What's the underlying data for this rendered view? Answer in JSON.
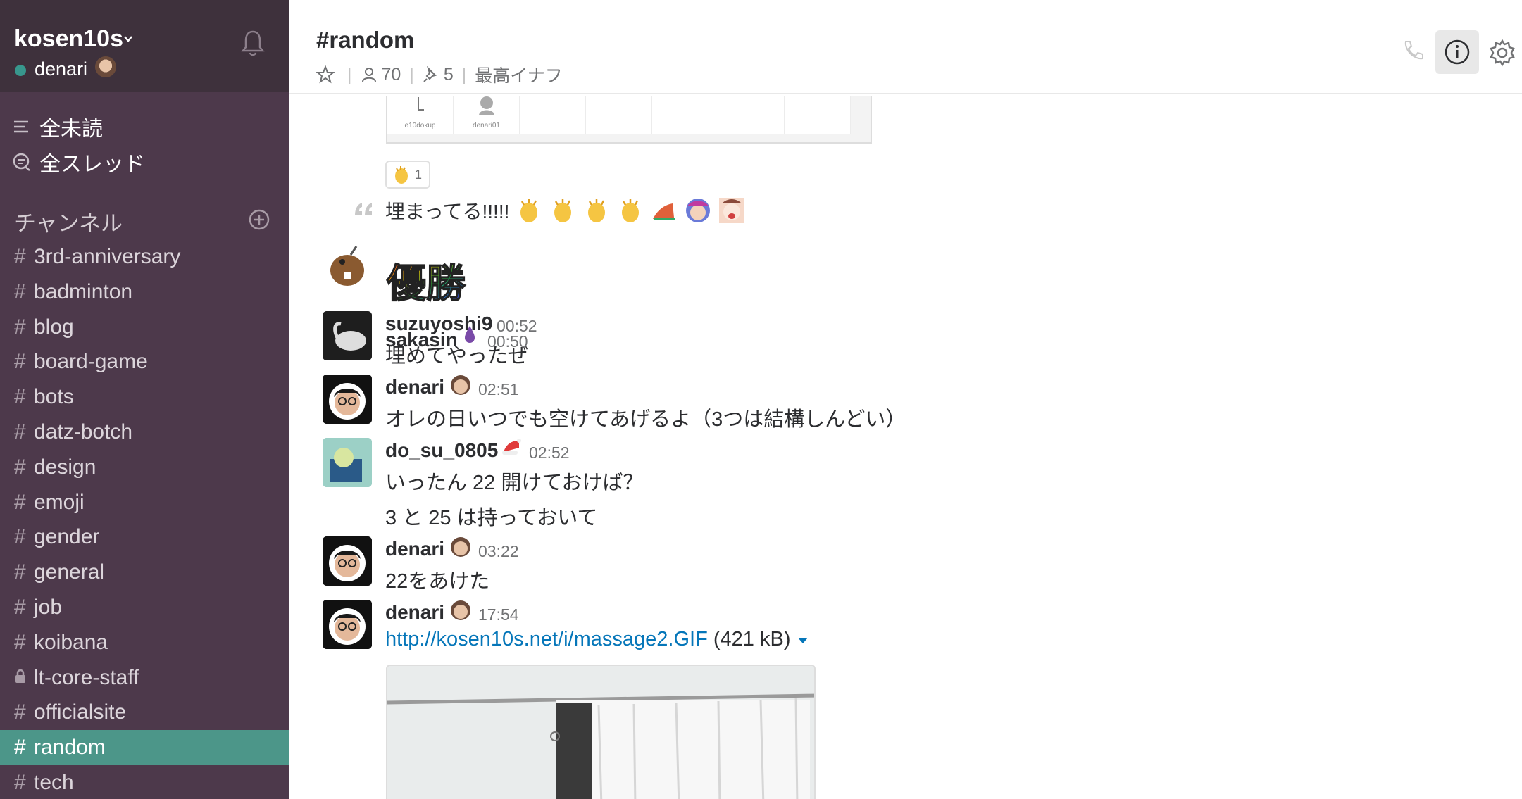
{
  "sidebar": {
    "team_name": "kosen10s",
    "user_name": "denari",
    "nav": [
      {
        "label": "全未読"
      },
      {
        "label": "全スレッド"
      }
    ],
    "channels_header": "チャンネル",
    "channels": [
      {
        "name": "3rd-anniversary",
        "private": false,
        "active": false
      },
      {
        "name": "badminton",
        "private": false,
        "active": false
      },
      {
        "name": "blog",
        "private": false,
        "active": false
      },
      {
        "name": "board-game",
        "private": false,
        "active": false
      },
      {
        "name": "bots",
        "private": false,
        "active": false
      },
      {
        "name": "datz-botch",
        "private": false,
        "active": false
      },
      {
        "name": "design",
        "private": false,
        "active": false
      },
      {
        "name": "emoji",
        "private": false,
        "active": false
      },
      {
        "name": "gender",
        "private": false,
        "active": false
      },
      {
        "name": "general",
        "private": false,
        "active": false
      },
      {
        "name": "job",
        "private": false,
        "active": false
      },
      {
        "name": "koibana",
        "private": false,
        "active": false
      },
      {
        "name": "lt-core-staff",
        "private": true,
        "active": false
      },
      {
        "name": "officialsite",
        "private": false,
        "active": false
      },
      {
        "name": "random",
        "private": false,
        "active": true
      },
      {
        "name": "tech",
        "private": false,
        "active": false
      }
    ]
  },
  "header": {
    "channel_name": "#random",
    "member_count": "70",
    "pinned_count": "5",
    "topic": "最高イナフ"
  },
  "messages": {
    "prev_image_labels": [
      "e10dokup",
      "denari01"
    ],
    "reaction_count": "1",
    "quote_text": "埋まってる!!!!!",
    "items": [
      {
        "sender": "sakasin",
        "time": "00:50",
        "body": "優勝"
      },
      {
        "sender": "suzuyoshi9",
        "time": "00:52",
        "body": "埋めてやったぜ"
      },
      {
        "sender": "denari",
        "time": "02:51",
        "body": "オレの日いつでも空けてあげるよ（3つは結構しんどい）"
      },
      {
        "sender": "do_su_0805",
        "time": "02:52",
        "body": "いったん 22 開けておけば？",
        "body2": "3 と 25 は持っておいて"
      },
      {
        "sender": "denari",
        "time": "03:22",
        "body": "22をあけた"
      },
      {
        "sender": "denari",
        "time": "17:54",
        "link": "http://kosen10s.net/i/massage2.GIF",
        "size": "(421 kB)"
      }
    ]
  },
  "colors": {
    "sidebar_bg": "#4d394b",
    "team_header_bg": "#3e313c",
    "active_channel": "#4c9689",
    "link": "#0576b9"
  }
}
